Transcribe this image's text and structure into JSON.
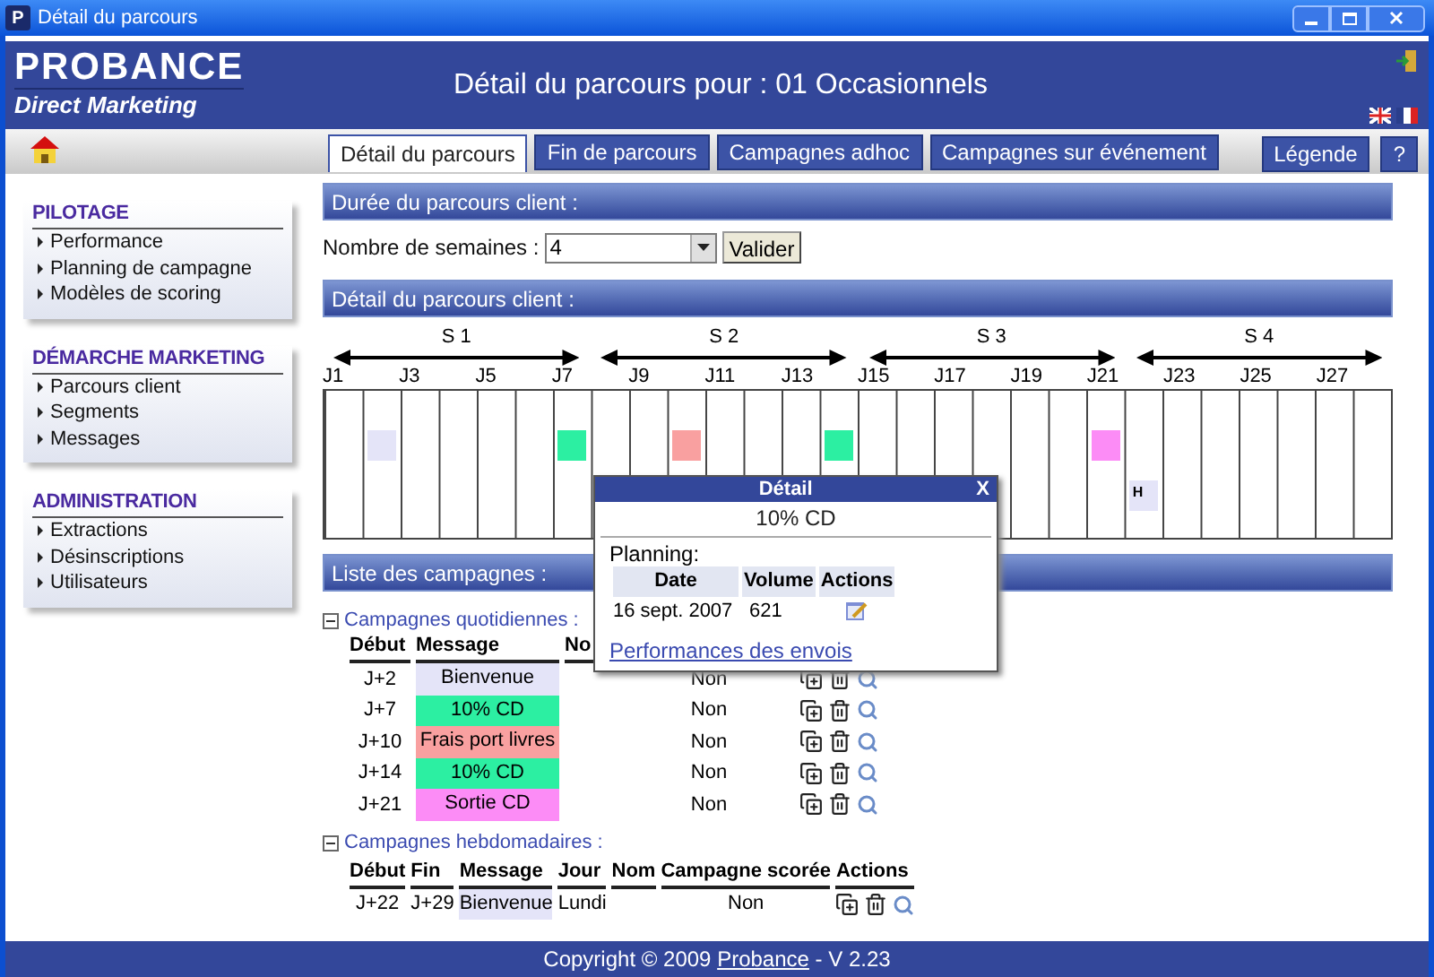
{
  "window": {
    "icon_letter": "P",
    "title": "Détail du parcours"
  },
  "header": {
    "logo": "PROBANCE",
    "tagline": "Direct Marketing",
    "title": "Détail du parcours pour : 01 Occasionnels"
  },
  "tabs": [
    {
      "label": "Détail du parcours",
      "selected": true
    },
    {
      "label": "Fin de parcours",
      "selected": false
    },
    {
      "label": "Campagnes adhoc",
      "selected": false
    },
    {
      "label": "Campagnes sur événement",
      "selected": false
    }
  ],
  "nav_buttons": [
    "Légende",
    "?"
  ],
  "sidebar": [
    {
      "title": "PILOTAGE",
      "items": [
        "Performance",
        "Planning de campagne",
        "Modèles de scoring"
      ]
    },
    {
      "title": "DÉMARCHE MARKETING",
      "items": [
        "Parcours client",
        "Segments",
        "Messages"
      ]
    },
    {
      "title": "ADMINISTRATION",
      "items": [
        "Extractions",
        "Désinscriptions",
        "Utilisateurs"
      ]
    }
  ],
  "duration": {
    "heading": "Durée du parcours client :",
    "label": "Nombre de semaines :",
    "value": "4",
    "button": "Valider"
  },
  "timeline": {
    "heading": "Détail du parcours client :",
    "weeks": [
      "S 1",
      "S 2",
      "S 3",
      "S 4"
    ],
    "day_pairs": [
      {
        "label": "J1",
        "second": {
          "kind": "daily",
          "color": "#e4e4f8"
        }
      },
      {
        "label": "J3"
      },
      {
        "label": "J5"
      },
      {
        "label": "J7",
        "first": {
          "kind": "daily",
          "color": "#2cefa2"
        }
      },
      {
        "label": "J9",
        "second": {
          "kind": "daily",
          "color": "#f9a0a0"
        }
      },
      {
        "label": "J11"
      },
      {
        "label": "J13",
        "second": {
          "kind": "daily",
          "color": "#2cefa2"
        }
      },
      {
        "label": "J15"
      },
      {
        "label": "J17"
      },
      {
        "label": "J19"
      },
      {
        "label": "J21",
        "first": {
          "kind": "daily",
          "color": "#fc8cf6"
        },
        "second": {
          "kind": "weekly",
          "color": "#e4e4f8",
          "text": "H"
        }
      },
      {
        "label": "J23"
      },
      {
        "label": "J25"
      },
      {
        "label": "J27"
      }
    ]
  },
  "popup": {
    "title": "Détail",
    "close": "X",
    "message": "10% CD",
    "planning_label": "Planning:",
    "columns": [
      "Date",
      "Volume",
      "Actions"
    ],
    "rows": [
      {
        "date": "16 sept. 2007",
        "volume": "621"
      }
    ],
    "link": "Performances des envois"
  },
  "campaigns": {
    "heading": "Liste des campagnes :",
    "daily": {
      "title": "Campagnes quotidiennes :",
      "expanded": true,
      "columns": [
        "Début",
        "Message",
        "No"
      ],
      "rows": [
        {
          "start": "J+2",
          "message": "Bienvenue",
          "color": "#e4e4f8",
          "scored": "Non"
        },
        {
          "start": "J+7",
          "message": "10% CD",
          "color": "#2cefa2",
          "scored": "Non"
        },
        {
          "start": "J+10",
          "message": "Frais port livres",
          "color": "#f9a0a0",
          "scored": "Non"
        },
        {
          "start": "J+14",
          "message": "10% CD",
          "color": "#2cefa2",
          "scored": "Non"
        },
        {
          "start": "J+21",
          "message": "Sortie CD",
          "color": "#fc8cf6",
          "scored": "Non"
        }
      ]
    },
    "weekly": {
      "title": "Campagnes hebdomadaires :",
      "expanded": true,
      "columns": [
        "Début",
        "Fin",
        "Message",
        "Jour",
        "Nom",
        "Campagne scorée",
        "Actions"
      ],
      "rows": [
        {
          "start": "J+22",
          "end": "J+29",
          "message": "Bienvenue",
          "color": "#e4e4f8",
          "day": "Lundi",
          "scored": "Non"
        }
      ]
    }
  },
  "footer": {
    "before": "Copyright © 2009 ",
    "link": "Probance",
    "after": " - V 2.23"
  }
}
